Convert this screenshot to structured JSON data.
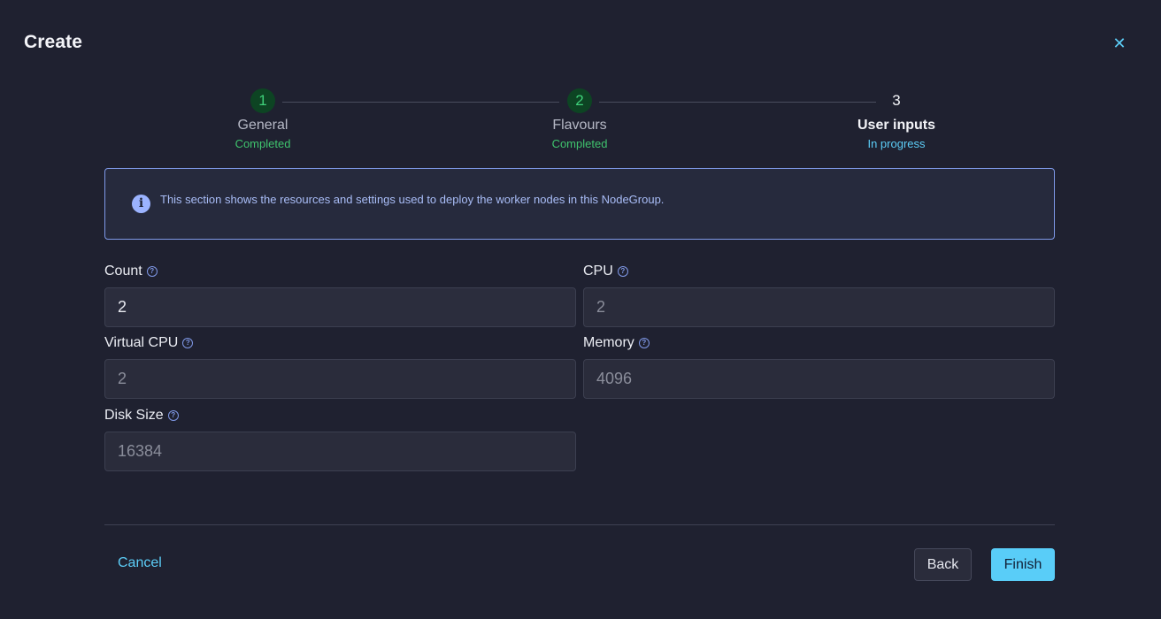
{
  "dialog": {
    "title": "Create",
    "close_icon": "close-icon",
    "close_glyph": "✕"
  },
  "stepper": {
    "steps": [
      {
        "number": "1",
        "title": "General",
        "status": "Completed"
      },
      {
        "number": "2",
        "title": "Flavours",
        "status": "Completed"
      },
      {
        "number": "3",
        "title": "User inputs",
        "status": "In progress"
      }
    ]
  },
  "info": {
    "icon": "info-icon",
    "icon_glyph": "i",
    "text": "This section shows the resources and settings used to deploy the worker nodes in this NodeGroup."
  },
  "form": {
    "help_glyph": "?",
    "count": {
      "label": "Count",
      "value": "2"
    },
    "cpu": {
      "label": "CPU",
      "value": "2"
    },
    "virtual_cpu": {
      "label": "Virtual CPU",
      "value": "2"
    },
    "memory": {
      "label": "Memory",
      "value": "4096"
    },
    "disk_size": {
      "label": "Disk Size",
      "value": "16384"
    }
  },
  "footer": {
    "cancel_label": "Cancel",
    "back_label": "Back",
    "finish_label": "Finish"
  },
  "colors": {
    "background": "#1f2130",
    "accent": "#59cdf8",
    "completed": "#3fc36d",
    "info_border": "#7e99e8"
  }
}
